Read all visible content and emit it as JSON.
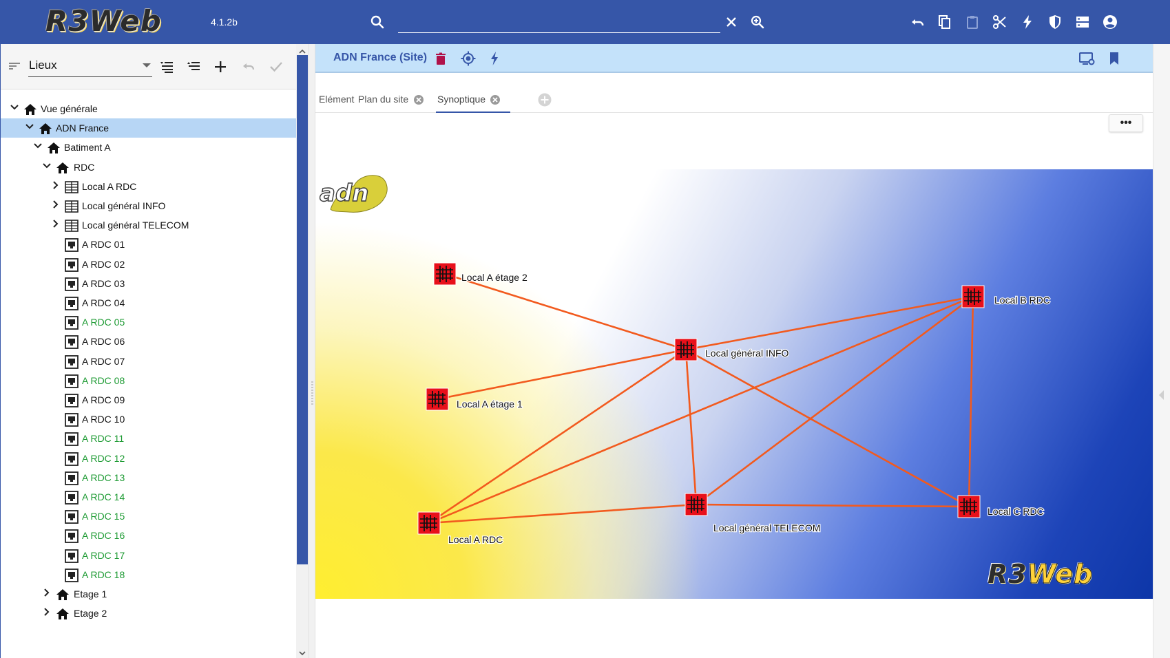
{
  "app": {
    "logo_text": "R3Web",
    "version": "4.1.2b"
  },
  "search": {
    "value": "",
    "placeholder": ""
  },
  "toolbar_icons": [
    "undo-icon",
    "copy-icon",
    "paste-icon",
    "cut-icon",
    "flash-icon",
    "shield-icon",
    "server-icon",
    "account-icon"
  ],
  "left_panel": {
    "selector_value": "Lieux",
    "toolbar_icons": [
      "sort-icon",
      "expand-list-icon",
      "collapse-list-icon",
      "add-icon",
      "undo-icon",
      "check-icon"
    ],
    "tree": [
      {
        "label": "Vue générale",
        "icon": "home-icon",
        "level": 0,
        "chevron": "down",
        "green": false,
        "selected": false
      },
      {
        "label": "ADN France",
        "icon": "home-icon",
        "level": 1,
        "chevron": "down",
        "green": false,
        "selected": true
      },
      {
        "label": "Batiment A",
        "icon": "home-icon",
        "level": 2,
        "chevron": "down",
        "green": false,
        "selected": false
      },
      {
        "label": "RDC",
        "icon": "home-icon",
        "level": 3,
        "chevron": "down",
        "green": false,
        "selected": false
      },
      {
        "label": "Local A RDC",
        "icon": "rack-icon",
        "level": 4,
        "chevron": "right",
        "green": false,
        "selected": false
      },
      {
        "label": "Local général INFO",
        "icon": "rack-icon",
        "level": 4,
        "chevron": "right",
        "green": false,
        "selected": false
      },
      {
        "label": "Local général TELECOM",
        "icon": "rack-icon",
        "level": 4,
        "chevron": "right",
        "green": false,
        "selected": false
      },
      {
        "label": "A RDC 01",
        "icon": "outlet-icon",
        "level": 4,
        "chevron": "",
        "green": false,
        "selected": false
      },
      {
        "label": "A RDC 02",
        "icon": "outlet-icon",
        "level": 4,
        "chevron": "",
        "green": false,
        "selected": false
      },
      {
        "label": "A RDC 03",
        "icon": "outlet-icon",
        "level": 4,
        "chevron": "",
        "green": false,
        "selected": false
      },
      {
        "label": "A RDC 04",
        "icon": "outlet-icon",
        "level": 4,
        "chevron": "",
        "green": false,
        "selected": false
      },
      {
        "label": "A RDC 05",
        "icon": "outlet-icon",
        "level": 4,
        "chevron": "",
        "green": true,
        "selected": false
      },
      {
        "label": "A RDC 06",
        "icon": "outlet-icon",
        "level": 4,
        "chevron": "",
        "green": false,
        "selected": false
      },
      {
        "label": "A RDC 07",
        "icon": "outlet-icon",
        "level": 4,
        "chevron": "",
        "green": false,
        "selected": false
      },
      {
        "label": "A RDC 08",
        "icon": "outlet-icon",
        "level": 4,
        "chevron": "",
        "green": true,
        "selected": false
      },
      {
        "label": "A RDC 09",
        "icon": "outlet-icon",
        "level": 4,
        "chevron": "",
        "green": false,
        "selected": false
      },
      {
        "label": "A RDC 10",
        "icon": "outlet-icon",
        "level": 4,
        "chevron": "",
        "green": false,
        "selected": false
      },
      {
        "label": "A RDC 11",
        "icon": "outlet-icon",
        "level": 4,
        "chevron": "",
        "green": true,
        "selected": false
      },
      {
        "label": "A RDC 12",
        "icon": "outlet-icon",
        "level": 4,
        "chevron": "",
        "green": true,
        "selected": false
      },
      {
        "label": "A RDC 13",
        "icon": "outlet-icon",
        "level": 4,
        "chevron": "",
        "green": true,
        "selected": false
      },
      {
        "label": "A RDC 14",
        "icon": "outlet-icon",
        "level": 4,
        "chevron": "",
        "green": true,
        "selected": false
      },
      {
        "label": "A RDC 15",
        "icon": "outlet-icon",
        "level": 4,
        "chevron": "",
        "green": true,
        "selected": false
      },
      {
        "label": "A RDC 16",
        "icon": "outlet-icon",
        "level": 4,
        "chevron": "",
        "green": true,
        "selected": false
      },
      {
        "label": "A RDC 17",
        "icon": "outlet-icon",
        "level": 4,
        "chevron": "",
        "green": true,
        "selected": false
      },
      {
        "label": "A RDC 18",
        "icon": "outlet-icon",
        "level": 4,
        "chevron": "",
        "green": true,
        "selected": false
      },
      {
        "label": "Etage 1",
        "icon": "home-icon",
        "level": 3,
        "chevron": "right",
        "green": false,
        "selected": false
      },
      {
        "label": "Etage 2",
        "icon": "home-icon",
        "level": 3,
        "chevron": "right",
        "green": false,
        "selected": false
      }
    ]
  },
  "detail": {
    "title": "ADN France (Site)",
    "title_icons": [
      "delete-icon",
      "locate-icon",
      "flash-icon"
    ],
    "right_icons": [
      "screen-settings-icon",
      "bookmark-icon"
    ],
    "tabs": [
      {
        "label": "Elément",
        "closable": false,
        "active": false
      },
      {
        "label": "Plan du site",
        "closable": true,
        "active": false
      },
      {
        "label": "Synoptique",
        "closable": true,
        "active": true
      }
    ],
    "more_label": "•••"
  },
  "synoptique": {
    "nodes": [
      {
        "id": "a2",
        "label": "Local A étage 2"
      },
      {
        "id": "info",
        "label": "Local général INFO"
      },
      {
        "id": "a1",
        "label": "Local A étage 1"
      },
      {
        "id": "brdc",
        "label": "Local B RDC"
      },
      {
        "id": "ardc",
        "label": "Local A RDC"
      },
      {
        "id": "tel",
        "label": "Local général TELECOM"
      },
      {
        "id": "crdc",
        "label": "Local C RDC"
      }
    ],
    "links": [
      [
        "a2",
        "info"
      ],
      [
        "a1",
        "info"
      ],
      [
        "info",
        "brdc"
      ],
      [
        "info",
        "tel"
      ],
      [
        "info",
        "crdc"
      ],
      [
        "info",
        "ardc"
      ],
      [
        "ardc",
        "brdc"
      ],
      [
        "ardc",
        "tel"
      ],
      [
        "tel",
        "brdc"
      ],
      [
        "tel",
        "crdc"
      ],
      [
        "brdc",
        "crdc"
      ]
    ],
    "link_color": "#f25a1e",
    "node_color": "#e8101a",
    "logo_left": "adn",
    "logo_right_r3": "R3",
    "logo_right_web": "Web"
  }
}
